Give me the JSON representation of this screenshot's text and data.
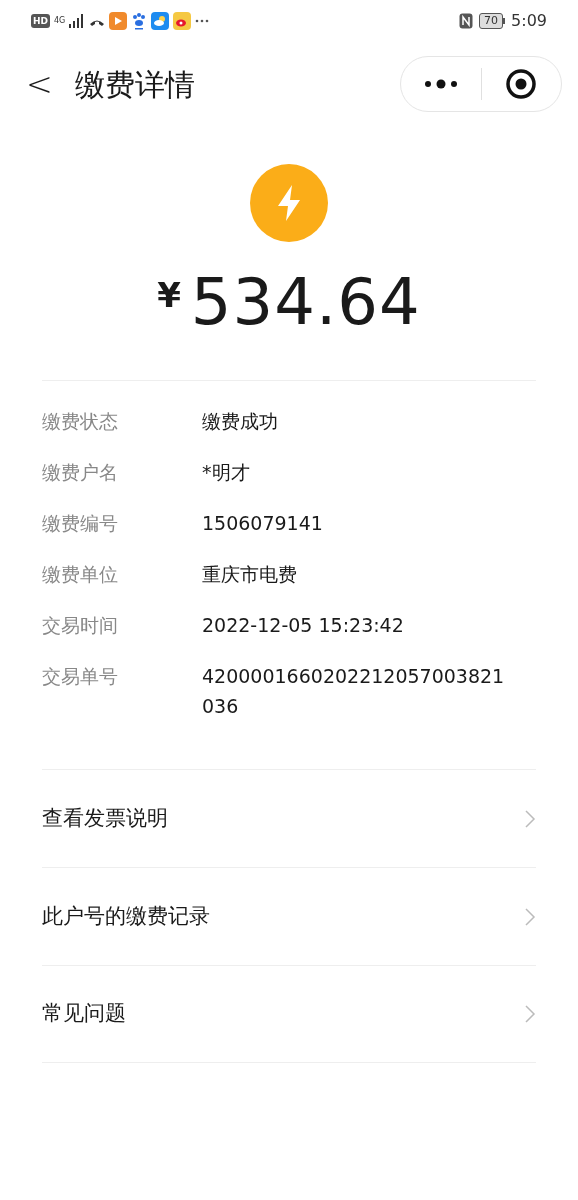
{
  "status_bar": {
    "network_badge": "HD",
    "network_type": "4G",
    "battery": "70",
    "time": "5:09"
  },
  "header": {
    "back": "<",
    "title": "缴费详情"
  },
  "amount": {
    "currency": "¥",
    "value": "534.64"
  },
  "details": [
    {
      "label": "缴费状态",
      "value": "缴费成功"
    },
    {
      "label": "缴费户名",
      "value": "*明才"
    },
    {
      "label": "缴费编号",
      "value": "1506079141"
    },
    {
      "label": "缴费单位",
      "value": "重庆市电费"
    },
    {
      "label": "交易时间",
      "value": "2022-12-05 15:23:42"
    },
    {
      "label": "交易单号",
      "value": "4200001660202212057003821036"
    }
  ],
  "links": [
    {
      "label": "查看发票说明"
    },
    {
      "label": "此户号的缴费记录"
    },
    {
      "label": "常见问题"
    }
  ]
}
